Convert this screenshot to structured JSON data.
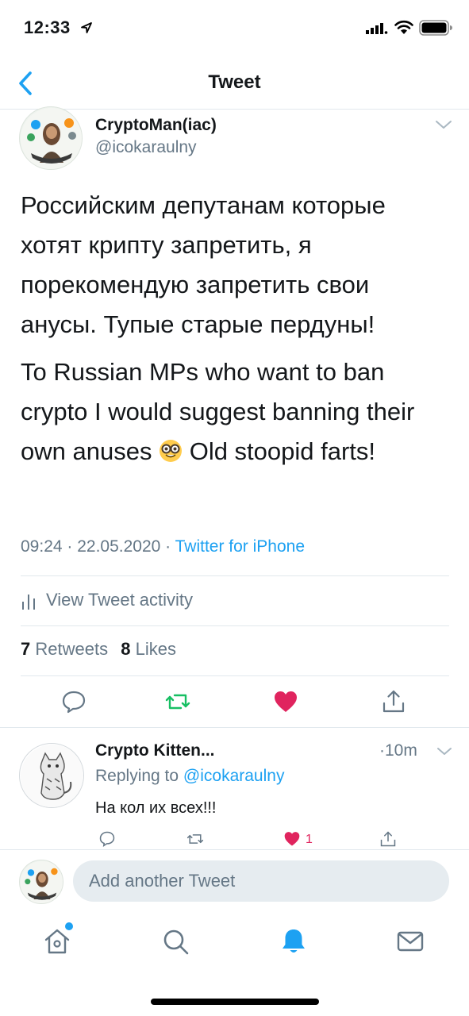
{
  "status_bar": {
    "time": "12:33",
    "icons": [
      "location-arrow-icon",
      "signal-icon",
      "wifi-icon",
      "battery-icon"
    ]
  },
  "header": {
    "title": "Tweet",
    "back_icon": "chevron-left-icon"
  },
  "tweet": {
    "author_name": "CryptoMan(iac)",
    "author_handle": "@icokaraulny",
    "text_ru": "Российским депутанам которые хотят крипту запретить, я порекомендую запретить свои анусы. Тупые старые пердуны!",
    "text_en_before_emoji": "To Russian MPs who want to ban crypto I would suggest banning their own anuses",
    "emoji": "nerd-face-emoji",
    "text_en_after_emoji": "Old stoopid farts!",
    "time": "09:24 · 22.05.2020 · ",
    "source": "Twitter for iPhone",
    "activity_label": "View Tweet activity",
    "retweets_count": "7",
    "retweets_label": "Retweets",
    "likes_count": "8",
    "likes_label": "Likes",
    "actions": [
      "reply-icon",
      "retweet-icon",
      "like-icon",
      "share-icon"
    ],
    "colors": {
      "retweet": "#17bf63",
      "like": "#e0245e",
      "link": "#1da1f2",
      "muted": "#657786"
    }
  },
  "reply": {
    "author_name": "Crypto Kitten...",
    "time": "·10m",
    "replying_prefix": "Replying to ",
    "replying_to": "@icokaraulny",
    "text": "На кол их всех!!!",
    "like_count": "1"
  },
  "compose": {
    "placeholder": "Add another Tweet"
  },
  "tab_bar": {
    "items": [
      "home-icon",
      "search-icon",
      "notifications-icon",
      "messages-icon"
    ],
    "active": "notifications-icon"
  }
}
